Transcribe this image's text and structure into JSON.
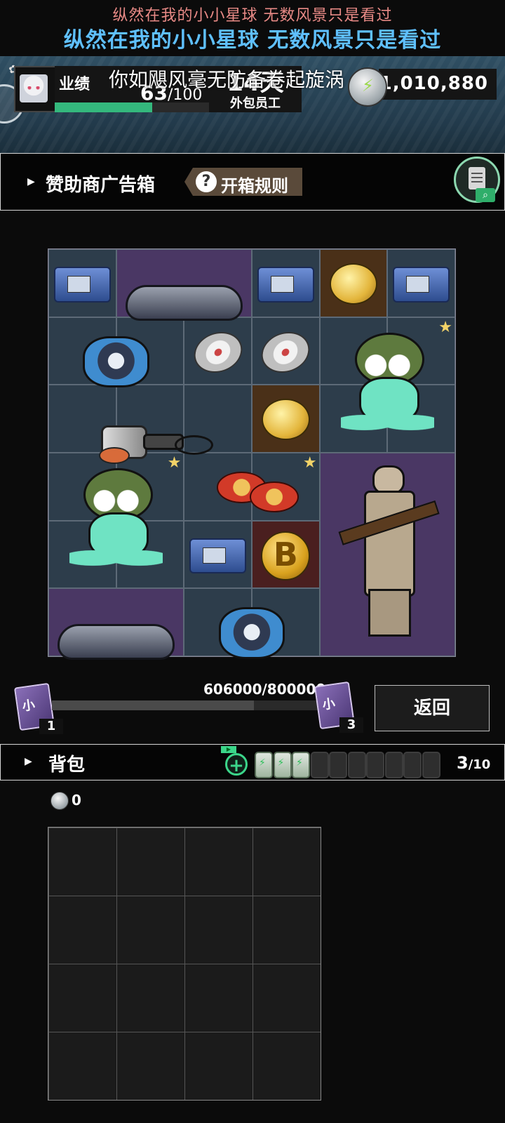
{
  "lyrics": {
    "line1": "纵然在我的小小星球 无数风景只是看过",
    "line2": "纵然在我的小小星球 无数风景只是看过",
    "overlay": "你如飓风毫无防备卷起旋涡"
  },
  "header": {
    "performance_label": "业绩",
    "performance_value": "63",
    "performance_max": "/100",
    "performance_progress": 0.63,
    "day_value": "14天",
    "role": "外包员工",
    "money": "1,010,880"
  },
  "sponsor": {
    "title": "赞助商广告箱",
    "rules_label": "开箱规则",
    "rules_icon": "?"
  },
  "loot_grid": {
    "items": [
      {
        "name": "tape-deck",
        "bg": "blue",
        "star": false
      },
      {
        "name": "vr-headset",
        "bg": "purple",
        "star": false
      },
      {
        "name": "tape-deck",
        "bg": "blue",
        "star": false
      },
      {
        "name": "gold-nugget",
        "bg": "brown",
        "star": false
      },
      {
        "name": "tape-deck",
        "bg": "blue",
        "star": false
      },
      {
        "name": "cd-player",
        "bg": "blue",
        "star": false
      },
      {
        "name": "cd-disc",
        "bg": "blue",
        "star": false
      },
      {
        "name": "cd-disc",
        "bg": "blue",
        "star": false
      },
      {
        "name": "frog-soldier",
        "bg": "blue",
        "star": true
      },
      {
        "name": "hair-dryer",
        "bg": "blue",
        "star": false
      },
      {
        "name": "gold-nugget",
        "bg": "brown",
        "star": false
      },
      {
        "name": "frog-soldier",
        "bg": "blue",
        "star": true
      },
      {
        "name": "sun-ornaments",
        "bg": "blue",
        "star": true
      },
      {
        "name": "terracotta-warrior",
        "bg": "purple",
        "star": false
      },
      {
        "name": "tape-deck",
        "bg": "blue",
        "star": false
      },
      {
        "name": "bitcoin",
        "bg": "red",
        "star": false
      },
      {
        "name": "vr-headset",
        "bg": "purple",
        "star": false
      },
      {
        "name": "cd-player",
        "bg": "blue",
        "star": false
      }
    ],
    "star_symbol": "★",
    "bitcoin_symbol": "B"
  },
  "progress": {
    "text": "606000/800000",
    "value": 606000,
    "max": 800000,
    "left_card_label": "小",
    "left_card_count": "1",
    "right_card_label": "小",
    "right_card_count": "3",
    "return_label": "返回"
  },
  "bag": {
    "title": "背包",
    "add_tag": "▶",
    "add_symbol": "+",
    "batteries_full": 3,
    "batteries_total": 10,
    "count_value": "3",
    "count_max": "/10",
    "coin_value": "0"
  },
  "colors": {
    "accent_green": "#34b87d",
    "lyric_top": "#e88a86",
    "lyric_blue": "#5fc0ff",
    "cell_blue": "#2d3d4b",
    "cell_purple": "#4a3764",
    "cell_brown": "#4a3018"
  }
}
